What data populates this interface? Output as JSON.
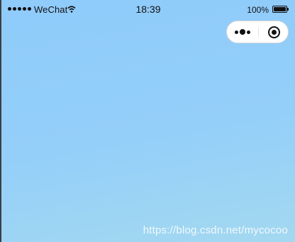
{
  "status_bar": {
    "carrier": "WeChat",
    "time": "18:39",
    "battery_percent": "100%",
    "battery_level": 1.0
  },
  "capsule": {
    "more_icon": "more-dots-icon",
    "close_icon": "target-close-icon"
  },
  "watermark": "https://blog.csdn.net/mycocoo",
  "colors": {
    "background_top": "#8fcbfb",
    "background_bottom": "#a3d8f0",
    "capsule_bg": "#ffffff"
  }
}
